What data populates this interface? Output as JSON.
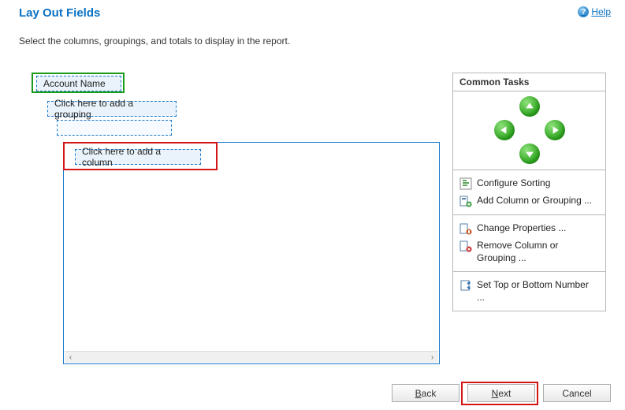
{
  "header": {
    "title": "Lay Out Fields",
    "help_label": "Help"
  },
  "instructions": "Select the columns, groupings, and totals to display in the report.",
  "layout": {
    "account_token": "Account Name",
    "add_grouping_token": "Click here to add a grouping",
    "add_column_token": "Click here to add a column"
  },
  "sidebar": {
    "header": "Common Tasks",
    "arrows": {
      "up": "move-up",
      "down": "move-down",
      "left": "move-left",
      "right": "move-right"
    },
    "tasks": {
      "configure_sorting": "Configure Sorting",
      "add_column": "Add Column or Grouping ...",
      "change_properties": "Change Properties ...",
      "remove_column": "Remove Column or Grouping ...",
      "set_top_bottom": "Set Top or Bottom Number ..."
    }
  },
  "buttons": {
    "back": "Back",
    "next": "Next",
    "cancel": "Cancel"
  }
}
